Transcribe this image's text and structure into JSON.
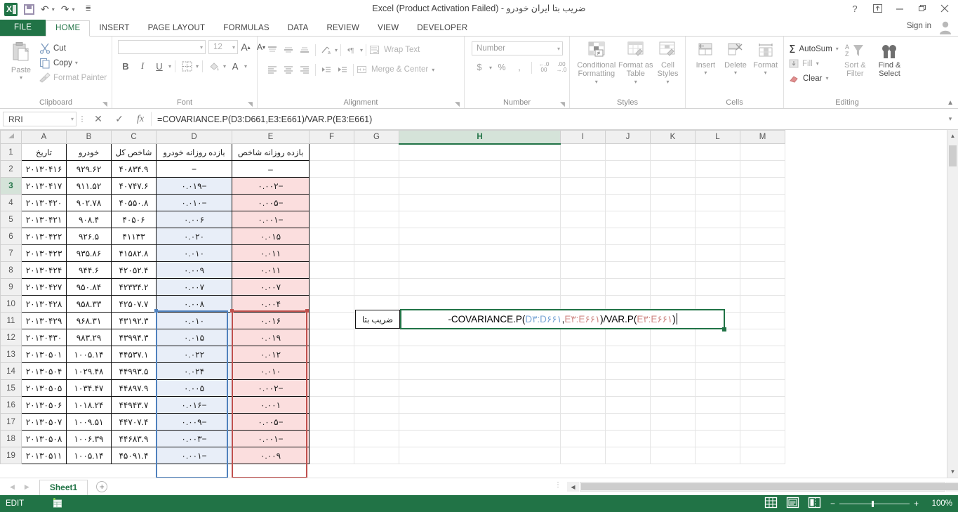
{
  "window": {
    "title": "ضریب بتا ایران خودرو - Excel (Product Activation Failed)",
    "help_icon": "?",
    "ribbon_display_icon": "ribbon-display-options-icon",
    "minimize_icon": "minimize-icon",
    "restore_icon": "restore-icon",
    "close_icon": "close-icon",
    "signin": "Sign in"
  },
  "quick_access": {
    "save_tip": "Save",
    "undo_tip": "Undo",
    "redo_tip": "Redo",
    "customize_tip": "Customize Quick Access Toolbar"
  },
  "tabs": [
    {
      "label": "FILE"
    },
    {
      "label": "HOME"
    },
    {
      "label": "INSERT"
    },
    {
      "label": "PAGE LAYOUT"
    },
    {
      "label": "FORMULAS"
    },
    {
      "label": "DATA"
    },
    {
      "label": "REVIEW"
    },
    {
      "label": "VIEW"
    },
    {
      "label": "DEVELOPER"
    }
  ],
  "ribbon": {
    "clipboard": {
      "title": "Clipboard",
      "paste": "Paste",
      "cut": "Cut",
      "copy": "Copy",
      "format_painter": "Format Painter"
    },
    "font": {
      "title": "Font",
      "font_name": "",
      "font_size": "12",
      "grow_font": "A",
      "shrink_font": "A",
      "bold": "B",
      "italic": "I",
      "underline": "U",
      "borders": "borders-icon",
      "fill_color": "A",
      "font_color": "A"
    },
    "alignment": {
      "title": "Alignment",
      "wrap_text": "Wrap Text",
      "merge_center": "Merge & Center"
    },
    "number": {
      "title": "Number",
      "format": "Number",
      "currency": "$",
      "percent": "%",
      "comma": ",",
      "increase_decimal": ".00",
      "decrease_decimal": ".00"
    },
    "styles": {
      "title": "Styles",
      "conditional_formatting": "Conditional Formatting",
      "format_as_table": "Format as Table",
      "cell_styles": "Cell Styles"
    },
    "cells": {
      "title": "Cells",
      "insert": "Insert",
      "delete": "Delete",
      "format": "Format"
    },
    "editing": {
      "title": "Editing",
      "autosum": "AutoSum",
      "fill": "Fill",
      "clear": "Clear",
      "sort_filter": "Sort & Filter",
      "find_select": "Find & Select"
    }
  },
  "formula_bar": {
    "name_box": "RRI",
    "cancel_icon": "✕",
    "enter_icon": "✓",
    "fx_icon": "fx",
    "formula": "=COVARIANCE.P(D3:D661,E3:E661)/VAR.P(E3:E661)",
    "expand_icon": "⌄"
  },
  "grid": {
    "columns": [
      "A",
      "B",
      "C",
      "D",
      "E",
      "F",
      "G",
      "H",
      "I",
      "J",
      "K",
      "L",
      "M"
    ],
    "active_column": "H",
    "active_row": "3",
    "rows": [
      {
        "n": "1",
        "A": "تاریخ",
        "B": "خودرو",
        "C": "شاخص کل",
        "D": "بازده روزانه خودرو",
        "E": "بازده روزانه شاخص"
      },
      {
        "n": "2",
        "A": "۲۰۱۳۰۴۱۶",
        "B": "۹۲۹.۶۲",
        "C": "۴۰۸۳۴.۹",
        "D": "−",
        "E": "‒"
      },
      {
        "n": "3",
        "A": "۲۰۱۳۰۴۱۷",
        "B": "۹۱۱.۵۲",
        "C": "۴۰۷۴۷.۶",
        "D": "−۰.۰۱۹",
        "E": "−۰.۰۰۲"
      },
      {
        "n": "4",
        "A": "۲۰۱۳۰۴۲۰",
        "B": "۹۰۲.۷۸",
        "C": "۴۰۵۵۰.۸",
        "D": "−۰.۰۱۰",
        "E": "−۰.۰۰۵"
      },
      {
        "n": "5",
        "A": "۲۰۱۳۰۴۲۱",
        "B": "۹۰۸.۴",
        "C": "۴۰۵۰۶",
        "D": "۰.۰۰۶",
        "E": "−۰.۰۰۱"
      },
      {
        "n": "6",
        "A": "۲۰۱۳۰۴۲۲",
        "B": "۹۲۶.۵",
        "C": "۴۱۱۳۳",
        "D": "۰.۰۲۰",
        "E": "۰.۰۱۵"
      },
      {
        "n": "7",
        "A": "۲۰۱۳۰۴۲۳",
        "B": "۹۳۵.۸۶",
        "C": "۴۱۵۸۲.۸",
        "D": "۰.۰۱۰",
        "E": "۰.۰۱۱"
      },
      {
        "n": "8",
        "A": "۲۰۱۳۰۴۲۴",
        "B": "۹۴۴.۶",
        "C": "۴۲۰۵۲.۴",
        "D": "۰.۰۰۹",
        "E": "۰.۰۱۱"
      },
      {
        "n": "9",
        "A": "۲۰۱۳۰۴۲۷",
        "B": "۹۵۰.۸۴",
        "C": "۴۲۳۳۴.۲",
        "D": "۰.۰۰۷",
        "E": "۰.۰۰۷"
      },
      {
        "n": "10",
        "A": "۲۰۱۳۰۴۲۸",
        "B": "۹۵۸.۳۳",
        "C": "۴۲۵۰۷.۷",
        "D": "۰.۰۰۸",
        "E": "۰.۰۰۴"
      },
      {
        "n": "11",
        "A": "۲۰۱۳۰۴۲۹",
        "B": "۹۶۸.۳۱",
        "C": "۴۳۱۹۲.۳",
        "D": "۰.۰۱۰",
        "E": "۰.۰۱۶"
      },
      {
        "n": "12",
        "A": "۲۰۱۳۰۴۳۰",
        "B": "۹۸۳.۲۹",
        "C": "۴۳۹۹۴.۳",
        "D": "۰.۰۱۵",
        "E": "۰.۰۱۹"
      },
      {
        "n": "13",
        "A": "۲۰۱۳۰۵۰۱",
        "B": "۱۰۰۵.۱۴",
        "C": "۴۴۵۳۷.۱",
        "D": "۰.۰۲۲",
        "E": "۰.۰۱۲"
      },
      {
        "n": "14",
        "A": "۲۰۱۳۰۵۰۴",
        "B": "۱۰۲۹.۴۸",
        "C": "۴۴۹۹۳.۵",
        "D": "۰.۰۲۴",
        "E": "۰.۰۱۰"
      },
      {
        "n": "15",
        "A": "۲۰۱۳۰۵۰۵",
        "B": "۱۰۳۴.۴۷",
        "C": "۴۴۸۹۷.۹",
        "D": "۰.۰۰۵",
        "E": "−۰.۰۰۲"
      },
      {
        "n": "16",
        "A": "۲۰۱۳۰۵۰۶",
        "B": "۱۰۱۸.۲۴",
        "C": "۴۴۹۴۳.۷",
        "D": "−۰.۰۱۶",
        "E": "۰.۰۰۱"
      },
      {
        "n": "17",
        "A": "۲۰۱۳۰۵۰۷",
        "B": "۱۰۰۹.۵۱",
        "C": "۴۴۷۰۷.۴",
        "D": "−۰.۰۰۹",
        "E": "−۰.۰۰۵"
      },
      {
        "n": "18",
        "A": "۲۰۱۳۰۵۰۸",
        "B": "۱۰۰۶.۳۹",
        "C": "۴۴۶۸۳.۹",
        "D": "−۰.۰۰۳",
        "E": "−۰.۰۰۱"
      },
      {
        "n": "19",
        "A": "۲۰۱۳۰۵۱۱",
        "B": "۱۰۰۵.۱۴",
        "C": "۴۵۰۹۱.۴",
        "D": "−۰.۰۰۱",
        "E": "۰.۰۰۹"
      }
    ],
    "label_cell": {
      "ref": "G3",
      "text": "ضریب بتا"
    },
    "edit_cell": {
      "ref": "H3",
      "prefix": "-COVARIANCE.P(",
      "ref1": "D۳:D۶۶۱",
      "comma": ",",
      "ref2": "E۳:E۶۶۱",
      "mid": ")/VAR.P(",
      "ref3": "E۳:E۶۶۱",
      "suffix": ")"
    }
  },
  "sheet_tabs": {
    "prev_icon": "◀",
    "next_icon": "▶",
    "sheets": [
      {
        "label": "Sheet1",
        "active": true
      }
    ],
    "add_sheet": "+"
  },
  "status_bar": {
    "mode": "EDIT",
    "macro_record_icon": "record-macro-icon",
    "view_normal": "normal-view-icon",
    "view_page_layout": "page-layout-view-icon",
    "view_page_break": "page-break-preview-icon",
    "zoom_out": "−",
    "zoom_in": "+",
    "zoom_level": "100%"
  },
  "colors": {
    "accent_green": "#217346",
    "col_d_fill": "#e8eef8",
    "col_e_fill": "#fbdede",
    "sel_blue": "#4f81bd",
    "sel_red": "#c0504d"
  }
}
